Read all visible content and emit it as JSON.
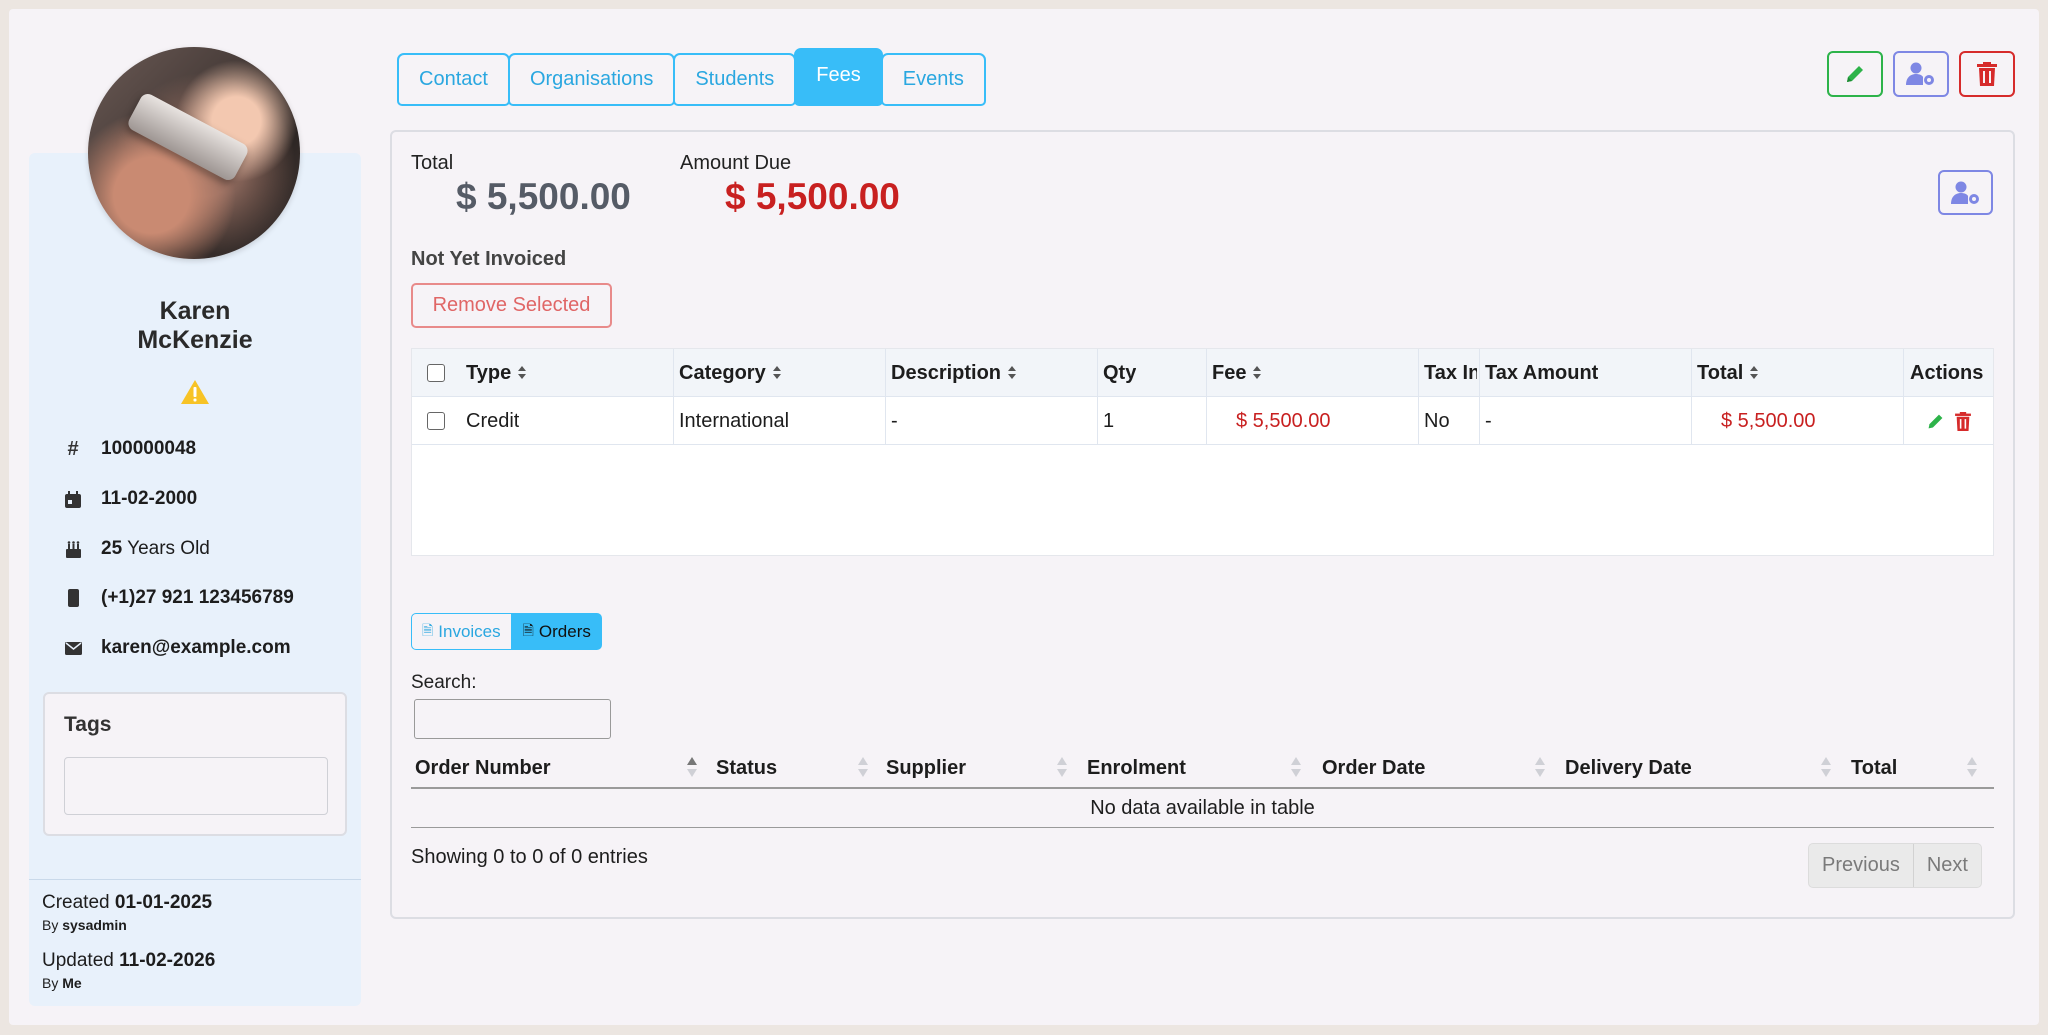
{
  "profile": {
    "first_name": "Karen",
    "last_name": "McKenzie",
    "id_number": "100000048",
    "dob": "11-02-2000",
    "age_value": "25",
    "age_suffix": "Years Old",
    "phone": "(+1)27 921 123456789",
    "email": "karen@example.com",
    "tags_title": "Tags",
    "created_label": "Created",
    "created_date": "01-01-2025",
    "created_by_label": "By",
    "created_by": "sysadmin",
    "updated_label": "Updated",
    "updated_date": "11-02-2026",
    "updated_by_label": "By",
    "updated_by": "Me"
  },
  "tabs": [
    {
      "label": "Contact"
    },
    {
      "label": "Organisations"
    },
    {
      "label": "Students"
    },
    {
      "label": "Fees",
      "active": true
    },
    {
      "label": "Events"
    }
  ],
  "summary": {
    "total_label": "Total",
    "total_value": "$ 5,500.00",
    "due_label": "Amount Due",
    "due_value": "$ 5,500.00",
    "section_title": "Not Yet Invoiced",
    "remove_button": "Remove Selected"
  },
  "fees_table": {
    "columns": [
      "Type",
      "Category",
      "Description",
      "Qty",
      "Fee",
      "Tax In",
      "Tax Amount",
      "Total",
      "Actions"
    ],
    "rows": [
      {
        "type": "Credit",
        "category": "International",
        "description": "-",
        "qty": "1",
        "fee": "$ 5,500.00",
        "tax_in": "No",
        "tax_amount": "-",
        "total": "$ 5,500.00"
      }
    ]
  },
  "docs_toggle": {
    "invoices": "Invoices",
    "orders": "Orders",
    "active": "Orders"
  },
  "orders": {
    "search_label": "Search:",
    "search_value": "",
    "columns": [
      "Order Number",
      "Status",
      "Supplier",
      "Enrolment",
      "Order Date",
      "Delivery Date",
      "Total"
    ],
    "empty_text": "No data available in table",
    "showing_text": "Showing 0 to 0 of 0 entries",
    "prev": "Previous",
    "next": "Next"
  },
  "icons": {
    "edit": "pencil-icon",
    "user_settings": "user-gear-icon",
    "delete": "trash-icon",
    "warning": "warning-icon"
  },
  "colors": {
    "accent": "#38bdf8",
    "danger": "#c82020",
    "success": "#2db34a",
    "indigo": "#7e87e4"
  }
}
